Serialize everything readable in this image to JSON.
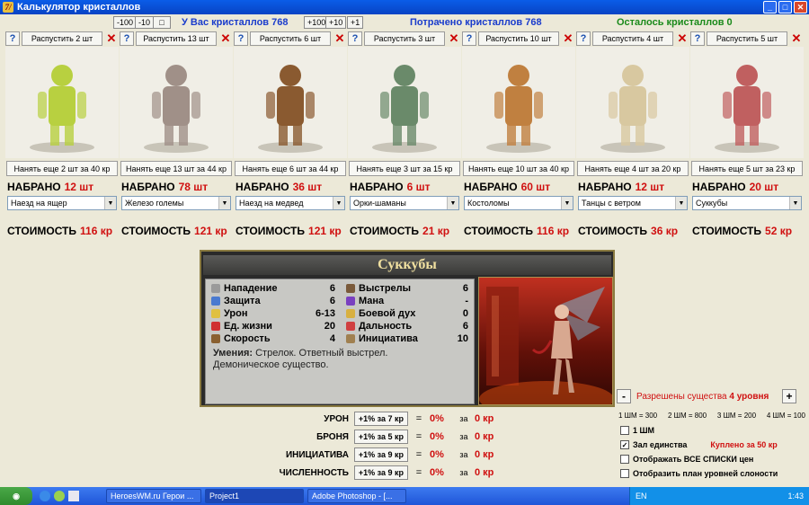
{
  "window": {
    "title": "Калькулятор кристаллов"
  },
  "topbar": {
    "btn_m100": "-100",
    "btn_m10": "-10",
    "btn_small": "□",
    "have_label": "У Вас кристаллов 768",
    "btn_p100": "+100",
    "btn_p10": "+10",
    "btn_p1": "+1",
    "spent_label": "Потрачено кристаллов 768",
    "left_label": "Осталось кристаллов 0",
    "colors": {
      "have": "#1a3ccc",
      "spent": "#1a3ccc",
      "left": "#1a8a1a"
    }
  },
  "units": [
    {
      "release": "Распустить 2 шт",
      "hire": "Нанять еще 2 шт за 40 кр",
      "count": "12 шт",
      "select": "Наезд на ящер",
      "cost": "116 кр"
    },
    {
      "release": "Распустить 13 шт",
      "hire": "Нанять еще 13 шт за 44 кр",
      "count": "78 шт",
      "select": "Железо големы",
      "cost": "121 кр"
    },
    {
      "release": "Распустить 6 шт",
      "hire": "Нанять еще 6 шт за 44 кр",
      "count": "36 шт",
      "select": "Наезд на медвед",
      "cost": "121 кр"
    },
    {
      "release": "Распустить 3 шт",
      "hire": "Нанять еще 3 шт за 15 кр",
      "count": "6 шт",
      "select": "Орки-шаманы",
      "cost": "21 кр"
    },
    {
      "release": "Распустить 10 шт",
      "hire": "Нанять еще 10 шт за 40 кр",
      "count": "60 шт",
      "select": "Костоломы",
      "cost": "116 кр"
    },
    {
      "release": "Распустить 4 шт",
      "hire": "Нанять еще 4 шт за 20 кр",
      "count": "12 шт",
      "select": "Танцы с ветром",
      "cost": "36 кр"
    },
    {
      "release": "Распустить 5 шт",
      "hire": "Нанять еще 5 шт за 23 кр",
      "count": "20 шт",
      "select": "Суккубы",
      "cost": "52 кр"
    }
  ],
  "labels": {
    "q": "?",
    "x": "✕",
    "nabrano": "НАБРАНО",
    "cost": "СТОИМОСТЬ",
    "arrow": "▼"
  },
  "creature": {
    "name": "Суккубы",
    "left_stats": [
      {
        "label": "Нападение",
        "value": "6",
        "icon": "sword-icon"
      },
      {
        "label": "Защита",
        "value": "6",
        "icon": "shield-icon"
      },
      {
        "label": "Урон",
        "value": "6-13",
        "icon": "damage-icon"
      },
      {
        "label": "Ед. жизни",
        "value": "20",
        "icon": "heart-icon"
      },
      {
        "label": "Скорость",
        "value": "4",
        "icon": "boot-icon"
      }
    ],
    "right_stats": [
      {
        "label": "Выстрелы",
        "value": "6",
        "icon": "arrow-icon"
      },
      {
        "label": "Мана",
        "value": "-",
        "icon": "mana-icon"
      },
      {
        "label": "Боевой дух",
        "value": "0",
        "icon": "morale-icon"
      },
      {
        "label": "Дальность",
        "value": "6",
        "icon": "target-icon"
      },
      {
        "label": "Инициатива",
        "value": "10",
        "icon": "hourglass-icon"
      }
    ],
    "skills_label": "Умения:",
    "skills_text": "Стрелок. Ответный выстрел.",
    "skills_text2": "Демоническое существо."
  },
  "upgrades": [
    {
      "label": "УРОН",
      "button": "+1% за 7 кр",
      "eq": "=",
      "pct": "0%",
      "za": "за",
      "kr": "0 кр"
    },
    {
      "label": "БРОНЯ",
      "button": "+1% за 5 кр",
      "eq": "=",
      "pct": "0%",
      "za": "за",
      "kr": "0 кр"
    },
    {
      "label": "ИНИЦИАТИВА",
      "button": "+1% за 9 кр",
      "eq": "=",
      "pct": "0%",
      "za": "за",
      "kr": "0 кр"
    },
    {
      "label": "ЧИСЛЕННОСТЬ",
      "button": "+1% за 9 кр",
      "eq": "=",
      "pct": "0%",
      "za": "за",
      "kr": "0 кр"
    }
  ],
  "right_panel": {
    "minus": "-",
    "plus": "+",
    "level_text": "Разрешены существа",
    "level_num": "4 уровня",
    "shm": [
      "1 ШМ = 300",
      "2 ШМ = 800",
      "3 ШМ = 200",
      "4 ШМ = 100"
    ],
    "cb1": "1 ШМ",
    "cb2": "Зал единства",
    "cb2_bought": "Куплено за 50 кр",
    "cb3": "Отображать ВСЕ СПИСКИ цен",
    "cb4": "Отобразить план уровней слоности",
    "check": "✓"
  },
  "taskbar": {
    "start": "◉",
    "tasks": [
      "HeroesWM.ru Герои ...",
      "Project1",
      "Adobe Photoshop - [..."
    ],
    "lang": "EN",
    "time": "1:43"
  }
}
